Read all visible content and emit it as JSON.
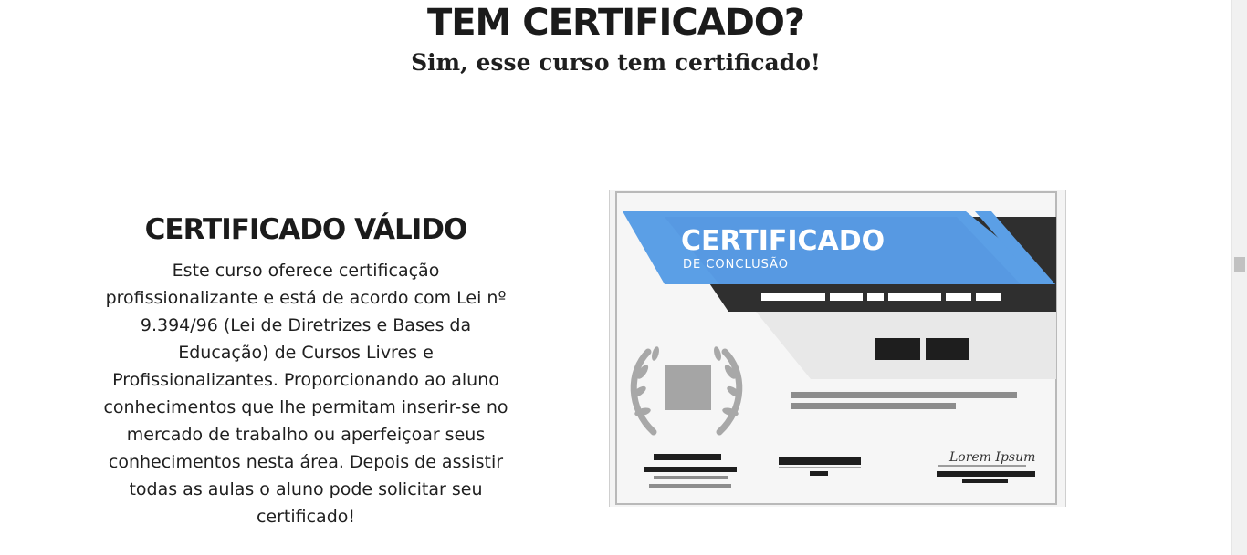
{
  "header": {
    "title": "TEM CERTIFICADO?",
    "subtitle": "Sim, esse curso tem certificado!"
  },
  "certificate_section": {
    "title": "CERTIFICADO VÁLIDO",
    "description": "Este curso oferece certificação profissionalizante e está de acordo com Lei nº 9.394/96 (Lei de Diretrizes e Bases da Educação) de Cursos Livres e Profissionalizantes. Proporcionando ao aluno conhecimentos que lhe permitam inserir-se no mercado de trabalho ou aperfeiçoar seus conhecimentos nesta área. Depois de assistir todas as aulas o aluno pode solicitar seu certificado!"
  },
  "certificate_image": {
    "heading": "CERTIFICADO",
    "subheading": "DE CONCLUSÃO",
    "signature": "Lorem Ipsum",
    "colors": {
      "accent_blue": "#5b9fe6",
      "dark_band": "#2e2e2e",
      "paper": "#f5f5f5",
      "seal_gray": "#a6a6a6"
    }
  }
}
